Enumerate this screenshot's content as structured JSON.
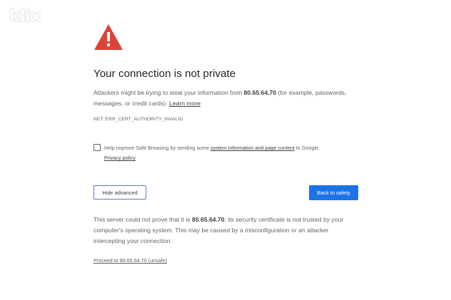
{
  "watermark": "klix",
  "icon": {
    "name": "warning-triangle-icon",
    "color": "#db4437"
  },
  "heading": "Your connection is not private",
  "body": {
    "intro": "Attackers might be trying to steal your information from ",
    "host": "80.65.64.70",
    "rest": " (for example, passwords, messages, or credit cards). ",
    "learn_more": "Learn more"
  },
  "error_code": "NET::ERR_CERT_AUTHORITY_INVALID",
  "safe_browsing": {
    "checked": false,
    "text_before": "Help improve Safe Browsing by sending some ",
    "link": "system information and page content",
    "text_after": " to Google.",
    "privacy_link": "Privacy policy"
  },
  "buttons": {
    "hide_advanced": "Hide advanced",
    "back_to_safety": "Back to safety"
  },
  "details": {
    "before": "This server could not prove that it is ",
    "host": "80.65.64.70",
    "after": "; its security certificate is not trusted by your computer's operating system. This may be caused by a misconfiguration or an attacker intercepting your connection."
  },
  "proceed_link": "Proceed to 80.65.64.70 (unsafe)",
  "colors": {
    "primary_button": "#1a73e8",
    "secondary_border": "#5b7cbc",
    "text": "#5f6368",
    "heading": "#202124"
  }
}
